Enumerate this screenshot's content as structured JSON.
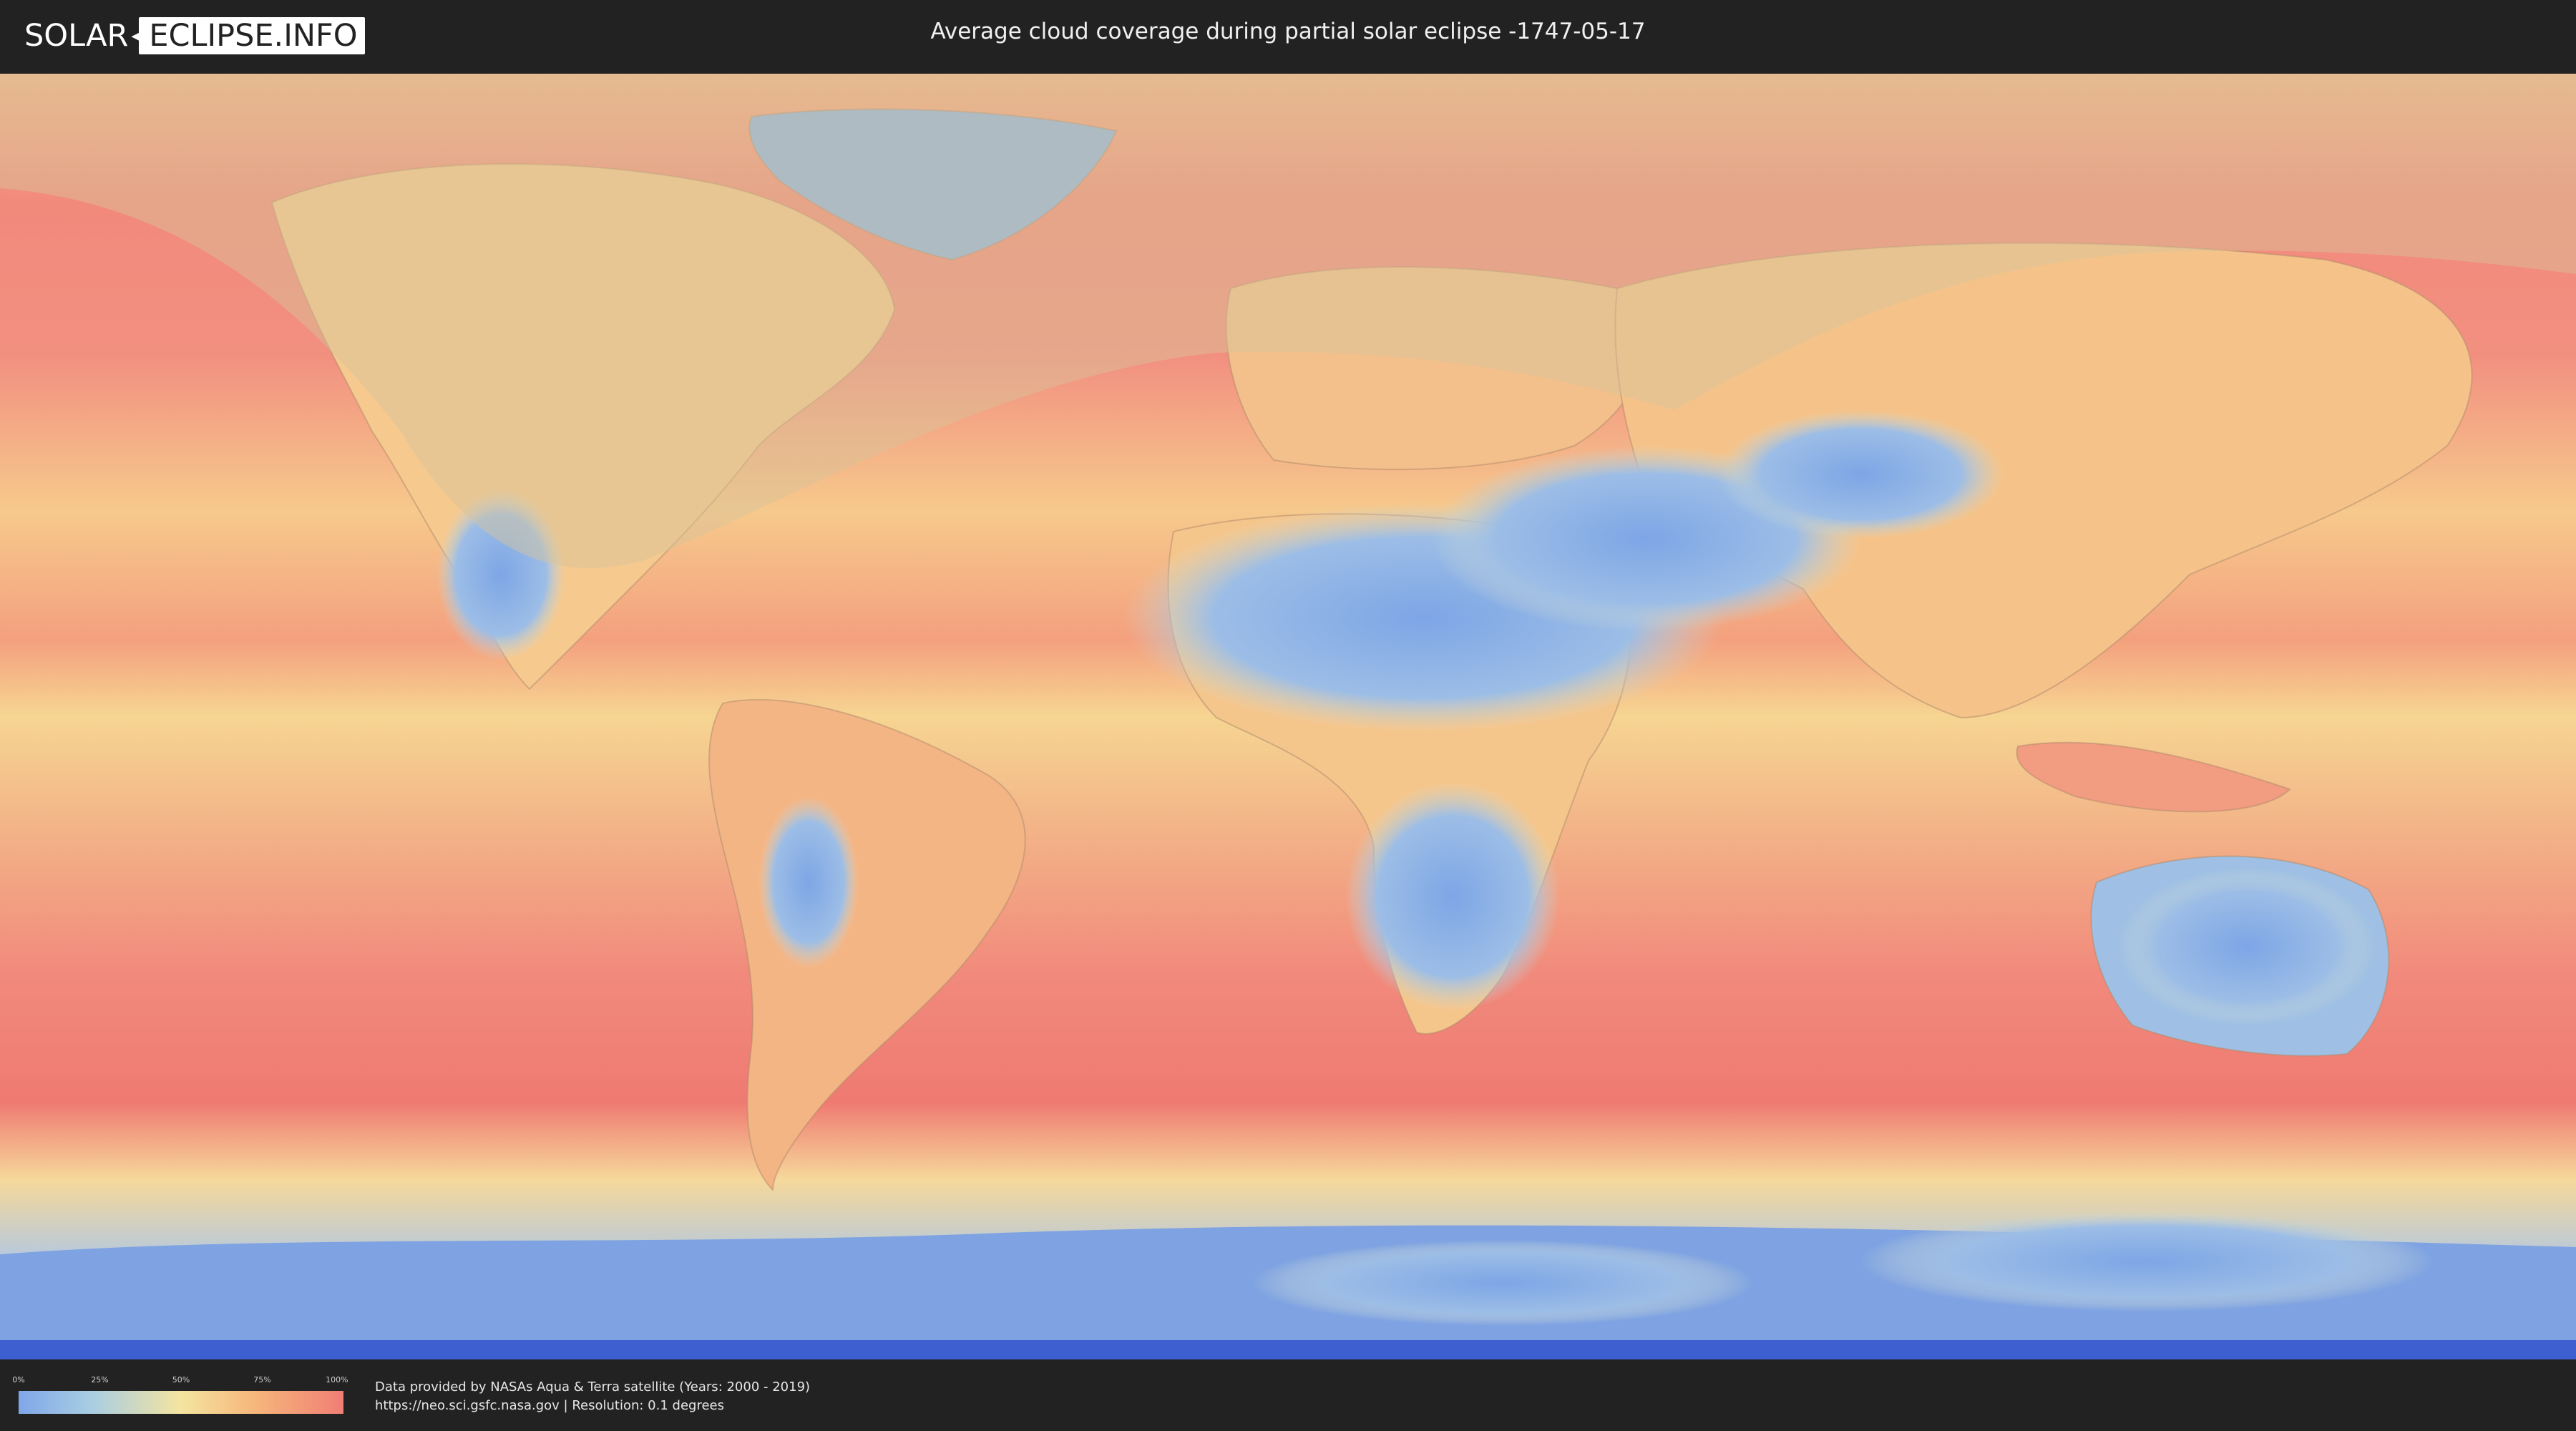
{
  "header": {
    "logo": {
      "part1": "SOLAR",
      "part2": "ECLIPSE.INFO"
    },
    "title": "Average cloud coverage during partial solar eclipse -1747-05-17"
  },
  "legend": {
    "ticks": [
      "0%",
      "25%",
      "50%",
      "75%",
      "100%"
    ],
    "gradient_colors": [
      "#7fa7e8",
      "#a8cde3",
      "#f4e4a0",
      "#f6b87c",
      "#f07e74"
    ]
  },
  "credits": {
    "line1": "Data provided by NASAs Aqua & Terra satellite (Years: 2000 - 2019)",
    "line2": "https://neo.sci.gsfc.nasa.gov | Resolution: 0.1 degrees"
  },
  "map": {
    "colors": {
      "ocean_high_cloud": "#f0857a",
      "mid_cloud": "#f5c88a",
      "low_cloud": "#8ab4e6",
      "very_low_cloud": "#5a82e0",
      "eclipse_shade": "#d9c49a"
    }
  }
}
